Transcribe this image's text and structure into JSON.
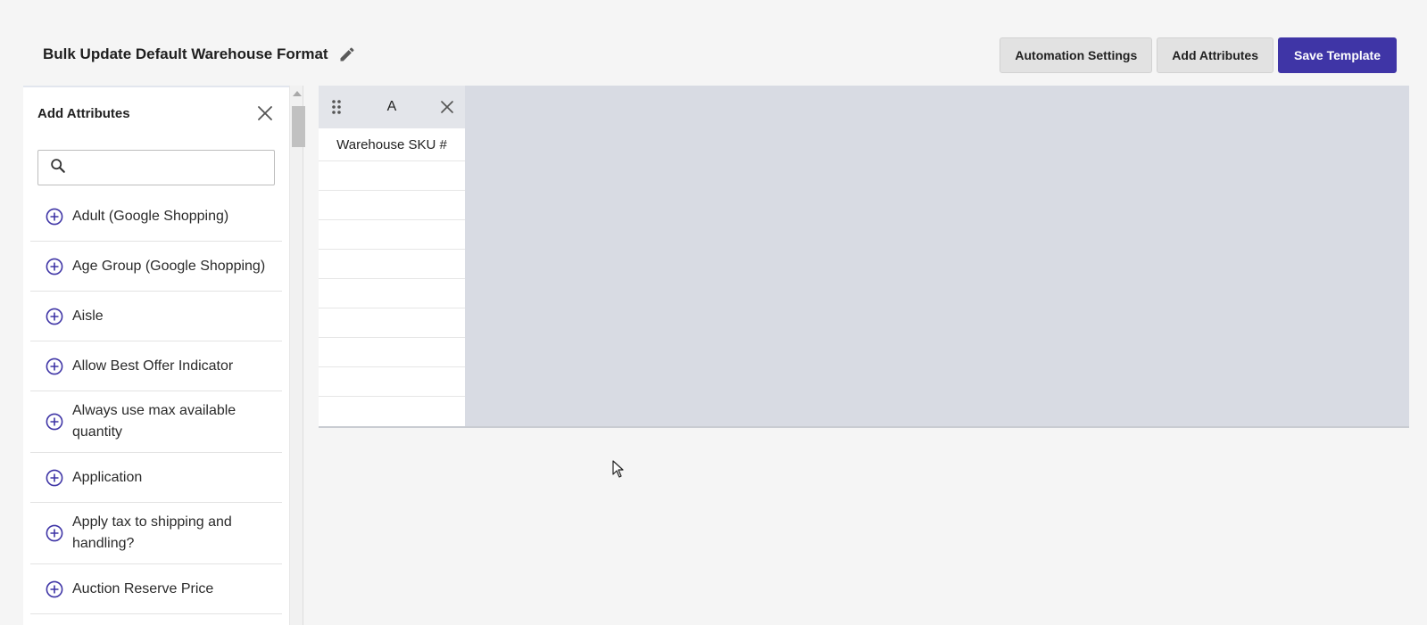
{
  "header": {
    "title": "Bulk Update Default Warehouse Format"
  },
  "actions": {
    "automation_label": "Automation Settings",
    "add_attributes_label": "Add Attributes",
    "save_label": "Save Template"
  },
  "panel": {
    "title": "Add Attributes",
    "search_placeholder": "",
    "items": [
      {
        "label": "Adult (Google Shopping)"
      },
      {
        "label": "Age Group (Google Shopping)"
      },
      {
        "label": "Aisle"
      },
      {
        "label": "Allow Best Offer Indicator"
      },
      {
        "label": "Always use max available quantity"
      },
      {
        "label": "Application"
      },
      {
        "label": "Apply tax to shipping and handling?"
      },
      {
        "label": "Auction Reserve Price"
      }
    ]
  },
  "grid": {
    "column": {
      "letter": "A",
      "cells": [
        "Warehouse SKU #",
        "",
        "",
        "",
        "",
        "",
        "",
        "",
        "",
        ""
      ]
    }
  },
  "colors": {
    "accent": "#3f35a6",
    "grid_background": "#d8dbe3"
  },
  "icons": [
    "edit-icon",
    "close-icon",
    "search-icon",
    "plus-circle-icon",
    "drag-handle-icon"
  ]
}
